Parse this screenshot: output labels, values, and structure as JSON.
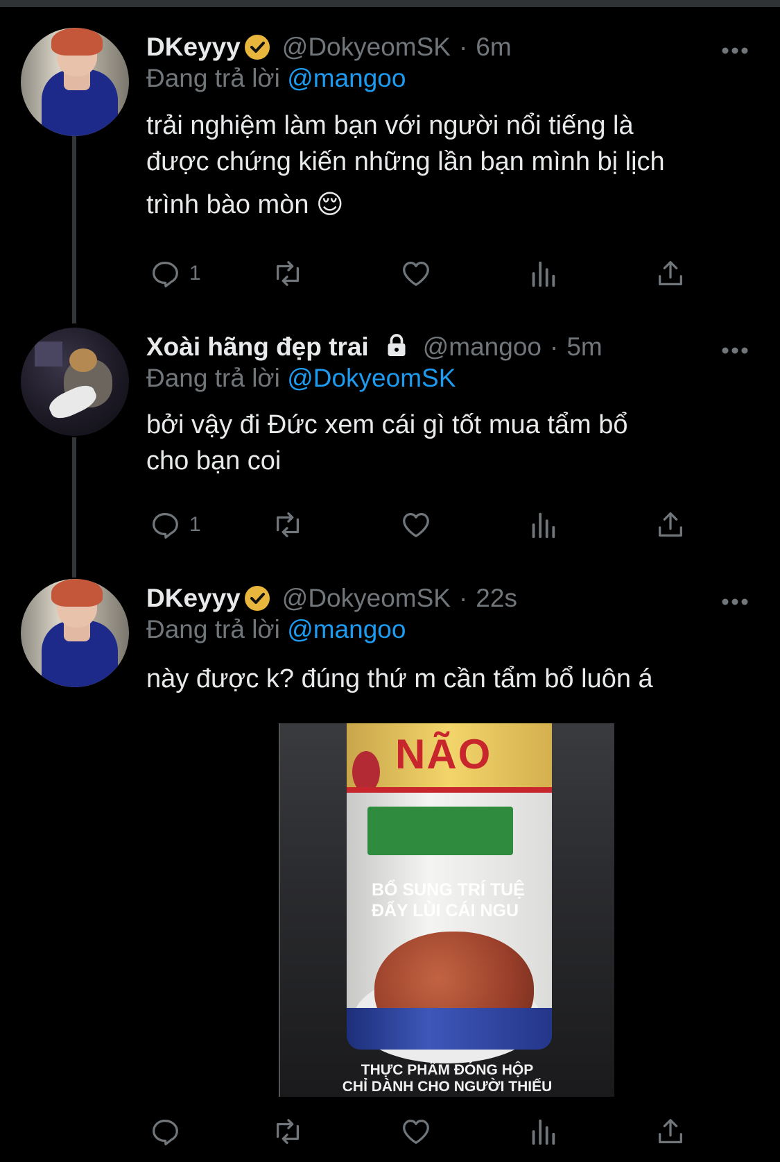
{
  "tweets": [
    {
      "name": "DKeyyy",
      "verified": true,
      "handle": "@DokyeomSK",
      "separator": "·",
      "time": "6m",
      "replying_prefix": "Đang trả lời",
      "replying_to": "@mangoo",
      "text_lines": [
        "trải nghiệm làm bạn với người nổi tiếng là",
        "được chứng kiến những lần bạn mình bị lịch",
        "trình bào mòn 😌"
      ],
      "reply_count": "1"
    },
    {
      "name": "Xoài hãng đẹp trai",
      "protected": true,
      "handle": "@mangoo",
      "separator": "·",
      "time": "5m",
      "replying_prefix": "Đang trả lời",
      "replying_to": "@DokyeomSK",
      "text_lines": [
        "bởi vậy đi Đức xem cái gì tốt mua tẩm bổ",
        "cho bạn coi"
      ],
      "reply_count": "1"
    },
    {
      "name": "DKeyyy",
      "verified": true,
      "handle": "@DokyeomSK",
      "separator": "·",
      "time": "22s",
      "replying_prefix": "Đang trả lời",
      "replying_to": "@mangoo",
      "text_lines": [
        "này được k? đúng thứ m cần tẩm bổ luôn á"
      ],
      "media": {
        "product_title": "NÃO",
        "tag_line_1": "BỔ SUNG TRÍ TUỆ",
        "tag_line_2": "ĐẨY LÙI CÁI NGU",
        "caption_line_1": "THỰC PHẨM ĐÓNG HỘP",
        "caption_line_2": "CHỈ DÀNH CHO NGƯỜI THIẾU"
      },
      "reply_count": ""
    }
  ],
  "icons": {
    "more": "more-dots-icon",
    "reply": "reply-icon",
    "retweet": "retweet-icon",
    "like": "heart-icon",
    "views": "views-icon",
    "share": "share-icon"
  },
  "colors": {
    "background": "#000000",
    "text": "#e7e9ea",
    "muted": "#71767b",
    "link": "#1d9bf0",
    "verified_badge": "#e8b63c"
  }
}
